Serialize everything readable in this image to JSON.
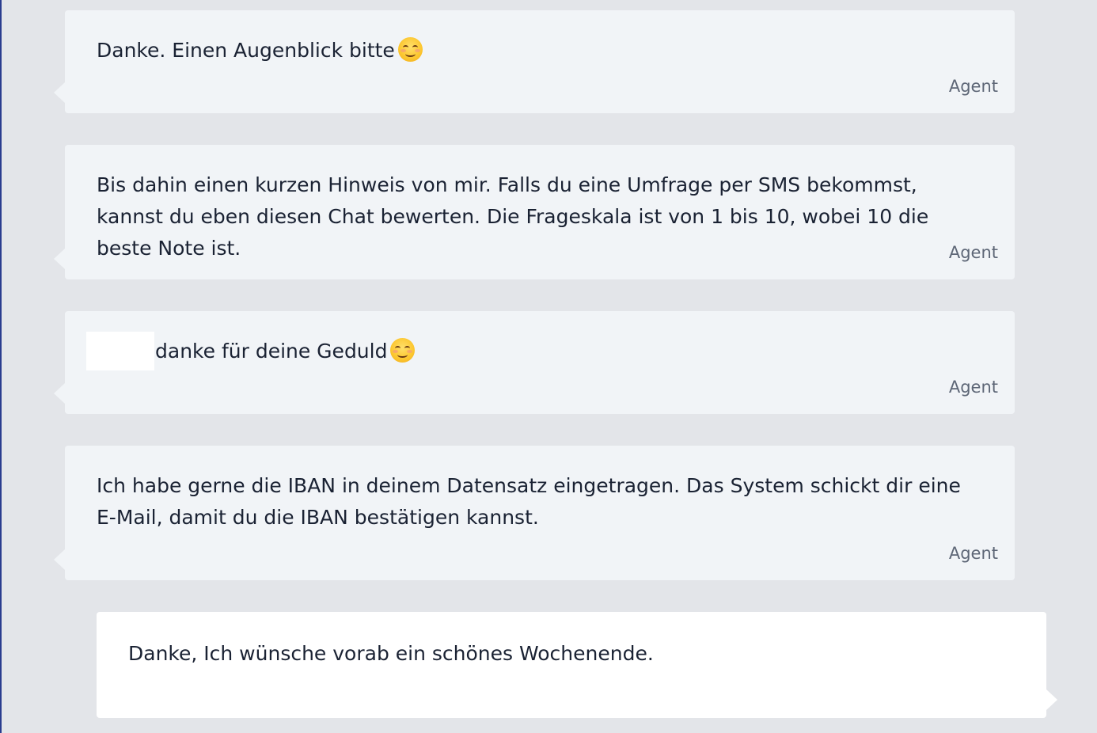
{
  "messages": [
    {
      "type": "agent",
      "text": "Danke. Einen Augenblick bitte",
      "emoji": "smiling-face-emoji",
      "sender": "Agent"
    },
    {
      "type": "agent",
      "text": "Bis dahin einen kurzen Hinweis von mir. Falls du eine Umfrage per SMS bekommst, kannst du eben diesen Chat bewerten. Die Frageskala ist von 1 bis 10, wobei 10 die beste Note ist.",
      "sender": "Agent"
    },
    {
      "type": "agent",
      "text": "danke für deine Geduld",
      "emoji": "smiling-face-emoji",
      "sender": "Agent"
    },
    {
      "type": "agent",
      "text": "Ich habe gerne die IBAN in deinem Datensatz eingetragen. Das System schickt dir eine E-Mail, damit du die IBAN bestätigen kannst.",
      "sender": "Agent"
    },
    {
      "type": "user",
      "text": "Danke, Ich wünsche vorab ein schönes Wochenende."
    }
  ],
  "colors": {
    "page_background": "#e3e5e9",
    "agent_bubble": "#f1f4f7",
    "user_bubble": "#ffffff",
    "text": "#1a2233",
    "sender_label": "#5d6676",
    "accent_edge": "#2a3d8f"
  }
}
